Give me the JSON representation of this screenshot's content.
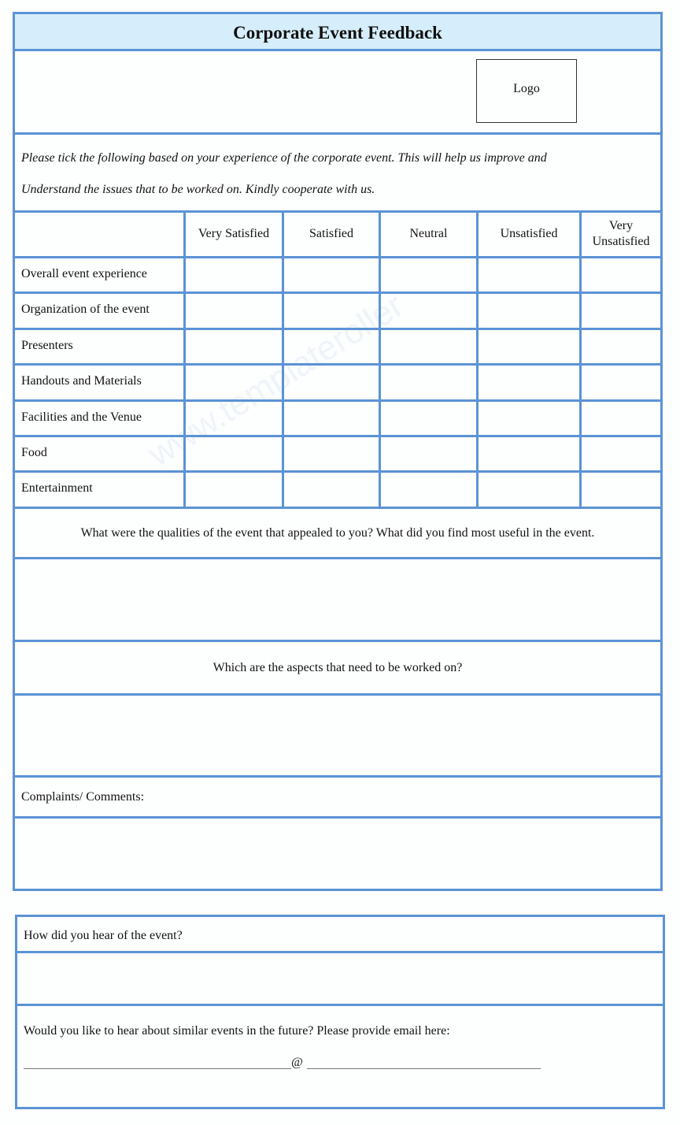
{
  "form": {
    "title": "Corporate Event Feedback",
    "logo_label": "Logo",
    "intro_line1": "Please tick the following based on your experience of the corporate event. This will help us improve and",
    "intro_line2": "Understand the issues that to be worked on. Kindly cooperate with us.",
    "rating_table": {
      "columns": [
        "Very Satisfied",
        "Satisfied",
        "Neutral",
        "Unsatisfied",
        "Very Unsatisfied"
      ],
      "column_last_line1": "Very",
      "column_last_line2": "Unsatisfied",
      "rows": [
        "Overall event experience",
        "Organization of the event",
        "Presenters",
        "Handouts and Materials",
        "Facilities and the Venue",
        "Food",
        "Entertainment"
      ]
    },
    "question_appealed": "What were the qualities of the event that appealed to you? What did you find most useful in the event.",
    "question_improve": "Which are the aspects that need to be worked on?",
    "complaints_label": "Complaints/ Comments:",
    "hear_question": "How did you hear of the event?",
    "email_question": "Would you like to hear about similar events in the future? Please provide email here:",
    "email_at": "@"
  },
  "colors": {
    "border": "#5b93d6",
    "header_bg": "#d6eefb"
  }
}
